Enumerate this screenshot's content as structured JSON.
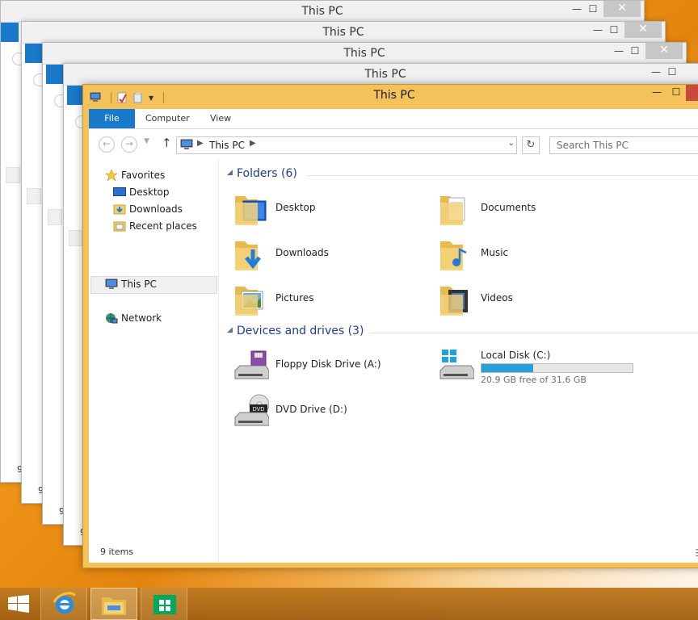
{
  "window_title": "This PC",
  "background_windows": [
    {
      "title": "This PC",
      "items_count": "9"
    },
    {
      "title": "This PC",
      "items_count": "9"
    },
    {
      "title": "This PC",
      "items_count": "9"
    },
    {
      "title": "This PC",
      "items_count": "9"
    }
  ],
  "title_controls": {
    "minimize": "—",
    "maximize": "☐",
    "close": "✕"
  },
  "ribbon": {
    "tabs": [
      {
        "label": "File"
      },
      {
        "label": "Computer"
      },
      {
        "label": "View"
      }
    ]
  },
  "address_bar": {
    "path": "This PC"
  },
  "search": {
    "placeholder": "Search This PC"
  },
  "nav_pane": {
    "favorites": {
      "label": "Favorites"
    },
    "favorite_items": [
      {
        "label": "Desktop",
        "icon": "desktop-icon"
      },
      {
        "label": "Downloads",
        "icon": "downloads-folder-icon"
      },
      {
        "label": "Recent places",
        "icon": "recent-places-icon"
      }
    ],
    "this_pc": {
      "label": "This PC"
    },
    "network": {
      "label": "Network"
    }
  },
  "folders_group": {
    "label": "Folders (6)"
  },
  "folders": [
    {
      "label": "Desktop",
      "icon": "desktop-folder-icon"
    },
    {
      "label": "Documents",
      "icon": "documents-folder-icon"
    },
    {
      "label": "Downloads",
      "icon": "downloads-folder-icon"
    },
    {
      "label": "Music",
      "icon": "music-folder-icon"
    },
    {
      "label": "Pictures",
      "icon": "pictures-folder-icon"
    },
    {
      "label": "Videos",
      "icon": "videos-folder-icon"
    }
  ],
  "devices_group": {
    "label": "Devices and drives (3)"
  },
  "devices": {
    "floppy": {
      "label": "Floppy Disk Drive (A:)"
    },
    "local_disk": {
      "label": "Local Disk (C:)",
      "free_text": "20.9 GB free of 31.6 GB",
      "used_fraction": 0.34
    },
    "dvd": {
      "label": "DVD Drive (D:)",
      "badge": "DVD"
    }
  },
  "status_bar": {
    "items": "9 items"
  },
  "taskbar": {
    "buttons": [
      {
        "name": "start-button",
        "icon": "windows-logo-icon"
      },
      {
        "name": "internet-explorer-button",
        "icon": "ie-icon"
      },
      {
        "name": "file-explorer-button",
        "icon": "file-explorer-icon"
      },
      {
        "name": "store-button",
        "icon": "store-icon"
      }
    ]
  },
  "colors": {
    "accent": "#1979ca",
    "title_bar": "#f3c25a",
    "group_header": "#1e3e8c",
    "disk_fill": "#26a0da",
    "close_button": "#c74a3a"
  }
}
